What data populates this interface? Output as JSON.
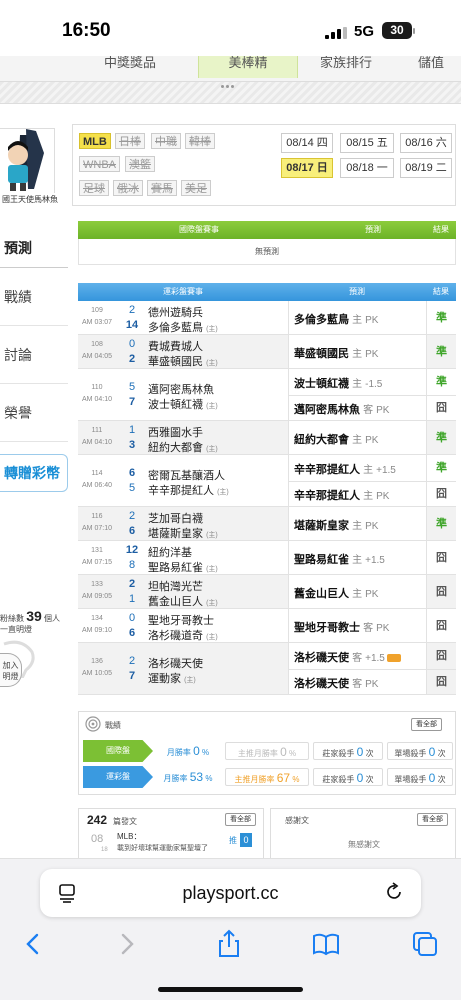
{
  "status_bar": {
    "time": "16:50",
    "network": "5G",
    "battery": "30"
  },
  "top_tabs": {
    "items": [
      "中獎獎品",
      "美棒精",
      "家族排行",
      "儲值"
    ]
  },
  "sidebar": {
    "user_name": "國王天使馬林魚",
    "nav": [
      "預測",
      "戰績",
      "討論",
      "榮譽",
      "轉贈彩幣"
    ],
    "fans_prefix": "粉絲數",
    "fans_count": "39",
    "fans_unit": "個人",
    "fans_sub": "一直明燈",
    "join_label": "加入明燈"
  },
  "leagues": {
    "row1": [
      "MLB",
      "日棒",
      "中職",
      "韓棒"
    ],
    "row2": [
      "WNBA",
      "澳籃"
    ],
    "row3": [
      "足球",
      "俄冰",
      "賽馬",
      "美足"
    ]
  },
  "dates": [
    [
      "08/14 四",
      "08/15 五",
      "08/16 六"
    ],
    [
      "08/17 日",
      "08/18 一",
      "08/19 二"
    ]
  ],
  "intl_table": {
    "h1": "國際盤賽事",
    "h2": "預測",
    "h3": "結果",
    "empty": "無預測"
  },
  "lottery_table": {
    "h1": "運彩盤賽事",
    "h2": "預測",
    "h3": "結果"
  },
  "home_mark": "(主)",
  "games": [
    {
      "no": "109",
      "time": "AM 03:07",
      "s1": "2",
      "t1": "德州遊騎兵",
      "s2": "14",
      "t2": "多倫多藍鳥",
      "preds": [
        {
          "team": "多倫多藍鳥",
          "side": "主",
          "line": "PK",
          "result": "準"
        }
      ]
    },
    {
      "no": "108",
      "time": "AM 04:05",
      "s1": "0",
      "t1": "費城費城人",
      "s2": "2",
      "t2": "華盛頓國民",
      "preds": [
        {
          "team": "華盛頓國民",
          "side": "主",
          "line": "PK",
          "result": "準"
        }
      ]
    },
    {
      "no": "110",
      "time": "AM 04:10",
      "s1": "5",
      "t1": "邁阿密馬林魚",
      "s2": "7",
      "t2": "波士頓紅襪",
      "preds": [
        {
          "team": "波士頓紅襪",
          "side": "主",
          "line": "-1.5",
          "result": "準"
        },
        {
          "team": "邁阿密馬林魚",
          "side": "客",
          "line": "PK",
          "result": "囧"
        }
      ]
    },
    {
      "no": "111",
      "time": "AM 04:10",
      "s1": "1",
      "t1": "西雅圖水手",
      "s2": "3",
      "t2": "紐約大都會",
      "preds": [
        {
          "team": "紐約大都會",
          "side": "主",
          "line": "PK",
          "result": "準"
        }
      ]
    },
    {
      "no": "114",
      "time": "AM 06:40",
      "s1": "6",
      "t1": "密爾瓦基釀酒人",
      "s2": "5",
      "t2": "辛辛那提紅人",
      "preds": [
        {
          "team": "辛辛那提紅人",
          "side": "主",
          "line": "+1.5",
          "result": "準"
        },
        {
          "team": "辛辛那提紅人",
          "side": "主",
          "line": "PK",
          "result": "囧"
        }
      ]
    },
    {
      "no": "116",
      "time": "AM 07:10",
      "s1": "2",
      "t1": "芝加哥白襪",
      "s2": "6",
      "t2": "堪薩斯皇家",
      "preds": [
        {
          "team": "堪薩斯皇家",
          "side": "主",
          "line": "PK",
          "result": "準"
        }
      ]
    },
    {
      "no": "131",
      "time": "AM 07:15",
      "s1": "12",
      "t1": "紐約洋基",
      "s2": "8",
      "t2": "聖路易紅雀",
      "preds": [
        {
          "team": "聖路易紅雀",
          "side": "主",
          "line": "+1.5",
          "result": "囧"
        }
      ]
    },
    {
      "no": "133",
      "time": "AM 09:05",
      "s1": "2",
      "t1": "坦帕灣光芒",
      "s2": "1",
      "t2": "舊金山巨人",
      "preds": [
        {
          "team": "舊金山巨人",
          "side": "主",
          "line": "PK",
          "result": "囧"
        }
      ]
    },
    {
      "no": "134",
      "time": "AM 09:10",
      "s1": "0",
      "t1": "聖地牙哥教士",
      "s2": "6",
      "t2": "洛杉磯道奇",
      "preds": [
        {
          "team": "聖地牙哥教士",
          "side": "客",
          "line": "PK",
          "result": "囧"
        }
      ]
    },
    {
      "no": "136",
      "time": "AM 10:05",
      "s1": "2",
      "t1": "洛杉磯天使",
      "s2": "7",
      "t2": "運動家",
      "preds": [
        {
          "team": "洛杉磯天使",
          "side": "客",
          "line": "+1.5",
          "result": "囧"
        },
        {
          "team": "洛杉磯天使",
          "side": "客",
          "line": "PK",
          "result": "囧"
        }
      ]
    }
  ],
  "record": {
    "title": "戰績",
    "see_all": "看全部",
    "rows": [
      {
        "label": "國際盤",
        "month_label": "月勝率",
        "month_val": "0",
        "pct": "%",
        "main_label": "主推月勝率",
        "main_val": "0",
        "zhuang_label": "莊家殺手",
        "zhuang_val": "0",
        "unit": "次",
        "dan_label": "單場殺手",
        "dan_val": "0"
      },
      {
        "label": "運彩盤",
        "month_label": "月勝率",
        "month_val": "53",
        "pct": "%",
        "main_label": "主推月勝率",
        "main_val": "67",
        "zhuang_label": "莊家殺手",
        "zhuang_val": "0",
        "unit": "次",
        "dan_label": "單場殺手",
        "dan_val": "0"
      }
    ]
  },
  "posts": {
    "count": "242",
    "label": "篇發文",
    "see_all": "看全部",
    "date": "08",
    "date_sub": "18",
    "title": "MLB：",
    "preview": "載到好壞球幫運動家幫聖壇了",
    "badge_label": "推",
    "badge_count": "0"
  },
  "thanks": {
    "label": "感謝文",
    "see_all": "看全部",
    "empty": "無感謝文"
  },
  "safari": {
    "url": "playsport.cc"
  },
  "colors": {
    "green": "#7cc034",
    "blue": "#3a9ae0",
    "win": "#3fa52a",
    "highlight": "#f8ef7b"
  }
}
